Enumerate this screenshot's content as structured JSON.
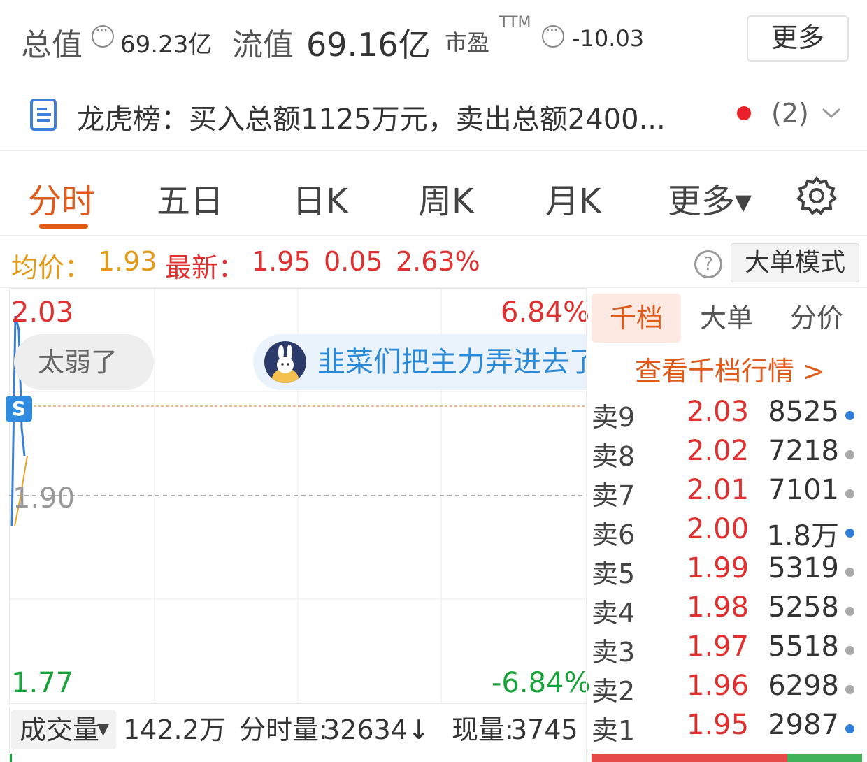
{
  "header": {
    "total_value_label": "总值",
    "total_value": "69.23亿",
    "float_value_label": "流值",
    "float_value": "69.16亿",
    "pe_label": "市盈",
    "pe_superscript": "TTM",
    "pe_value": "-10.03",
    "more_button": "更多"
  },
  "notice": {
    "text": "龙虎榜：买入总额1125万元，卖出总额2400...",
    "count": "(2)"
  },
  "tabs": [
    {
      "label": "分时",
      "active": true
    },
    {
      "label": "五日",
      "active": false
    },
    {
      "label": "日K",
      "active": false
    },
    {
      "label": "周K",
      "active": false
    },
    {
      "label": "月K",
      "active": false
    },
    {
      "label": "更多▾",
      "active": false
    }
  ],
  "info": {
    "avg_label": "均价：",
    "avg_value": "1.93",
    "latest_label": "最新：",
    "latest_value": "1.95",
    "change": "0.05",
    "change_pct": "2.63%",
    "help_icon": "?",
    "big_order_button": "大单模式"
  },
  "chart": {
    "high": "2.03",
    "high_pct": "6.84%",
    "mid": "1.90",
    "low": "1.77",
    "low_pct": "-6.84%",
    "bubble_left": "太弱了",
    "bubble_right": "韭菜们把主力弄进去了",
    "s_badge": "S"
  },
  "chart_data": {
    "type": "line",
    "ylim": [
      1.77,
      2.03
    ],
    "baseline": 1.9,
    "series": [
      {
        "values": [
          1.88,
          2.03,
          2.02,
          1.95,
          1.93
        ]
      },
      {
        "values": [
          1.88,
          1.9,
          1.93
        ]
      }
    ]
  },
  "orderbook": {
    "tabs": [
      "千档",
      "大单",
      "分价"
    ],
    "link": "查看千档行情 >",
    "rows": [
      {
        "label": "卖9",
        "price": "2.03",
        "qty": "8525",
        "dot": "#2f7fd6"
      },
      {
        "label": "卖8",
        "price": "2.02",
        "qty": "7218",
        "dot": "#aaaaaa"
      },
      {
        "label": "卖7",
        "price": "2.01",
        "qty": "7101",
        "dot": "#aaaaaa"
      },
      {
        "label": "卖6",
        "price": "2.00",
        "qty": "1.8万",
        "dot": "#2f7fd6"
      },
      {
        "label": "卖5",
        "price": "1.99",
        "qty": "5319",
        "dot": "#aaaaaa"
      },
      {
        "label": "卖4",
        "price": "1.98",
        "qty": "5258",
        "dot": "#aaaaaa"
      },
      {
        "label": "卖3",
        "price": "1.97",
        "qty": "5518",
        "dot": "#aaaaaa"
      },
      {
        "label": "卖2",
        "price": "1.96",
        "qty": "6298",
        "dot": "#aaaaaa"
      },
      {
        "label": "卖1",
        "price": "1.95",
        "qty": "2987",
        "dot": "#2f7fd6"
      }
    ]
  },
  "volume": {
    "select_label": "成交量",
    "total": "142.2万",
    "tick_label": "分时量:",
    "tick_value": "32634↓",
    "current_label": "现量:",
    "current_value": "3745"
  }
}
